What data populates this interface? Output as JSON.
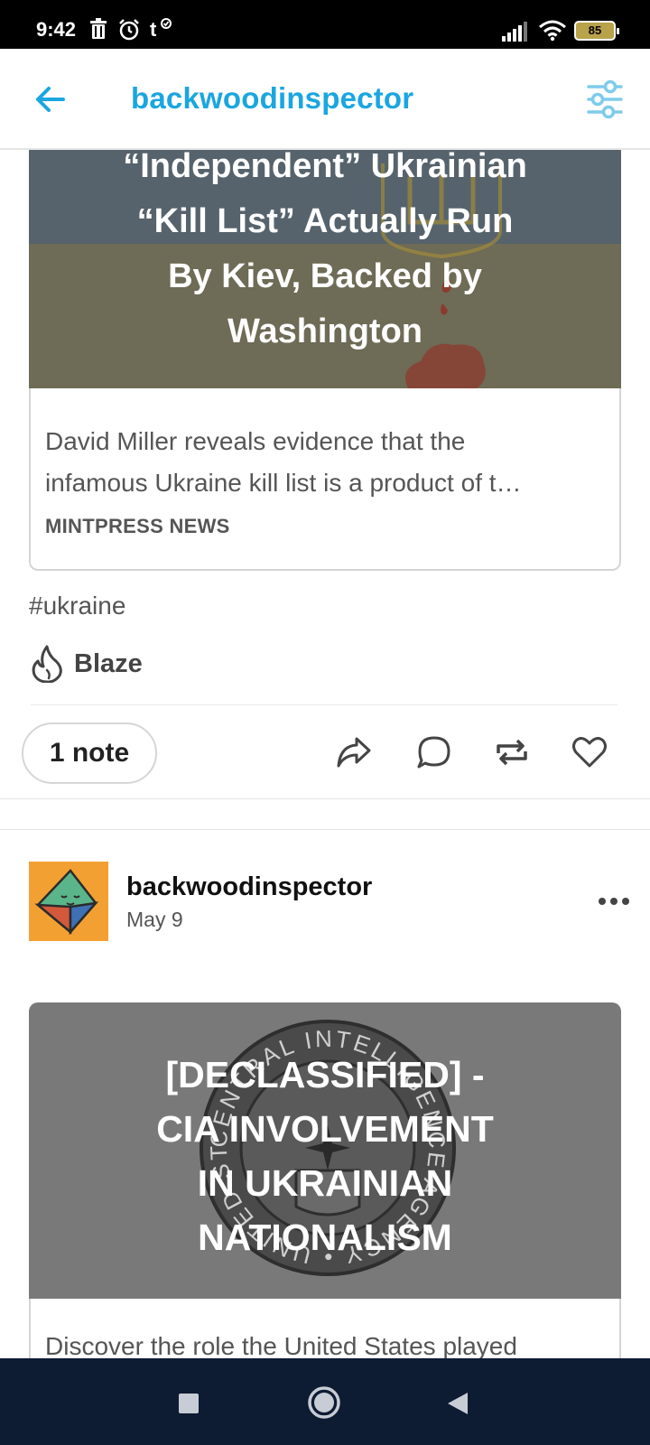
{
  "status_bar": {
    "time": "9:42",
    "battery": "85"
  },
  "app_bar": {
    "title": "backwoodinspector",
    "back_icon": "arrow-left-icon",
    "filter_icon": "sliders-icon",
    "accent_color": "#1ba6e0"
  },
  "post1": {
    "image_headline": "“Independent” Ukrainian “Kill List” Actually Run By Kiev, Backed by Washington",
    "headline_lines": [
      "“Independent” Ukrainian",
      "“Kill List” Actually Run",
      "By Kiev, Backed by",
      "Washington"
    ],
    "card_description": "David Miller reveals evidence that the infamous Ukraine kill list is a product of t…",
    "card_desc_lines": [
      "David Miller reveals evidence that the",
      "infamous Ukraine kill list is a product of t…"
    ],
    "card_source": "MINTPRESS NEWS",
    "tag": "#ukraine",
    "blaze_label": "Blaze",
    "notes_label": "1 note",
    "actions": [
      "share-icon",
      "reply-icon",
      "reblog-icon",
      "like-icon"
    ]
  },
  "post2": {
    "username": "backwoodinspector",
    "date": "May 9",
    "headline_lines": [
      "[DECLASSIFIED] -",
      "CIA INVOLVEMENT",
      "IN UKRAINIAN",
      "NATIONALISM"
    ],
    "seal_text": "CENTRAL INTELLIGENCE AGENCY • UNITED STATES OF AMERICA",
    "card_description": "Discover the role the United States played"
  },
  "nav_bar": {
    "buttons": [
      "recent-apps-icon",
      "home-icon",
      "back-triangle-icon"
    ]
  }
}
